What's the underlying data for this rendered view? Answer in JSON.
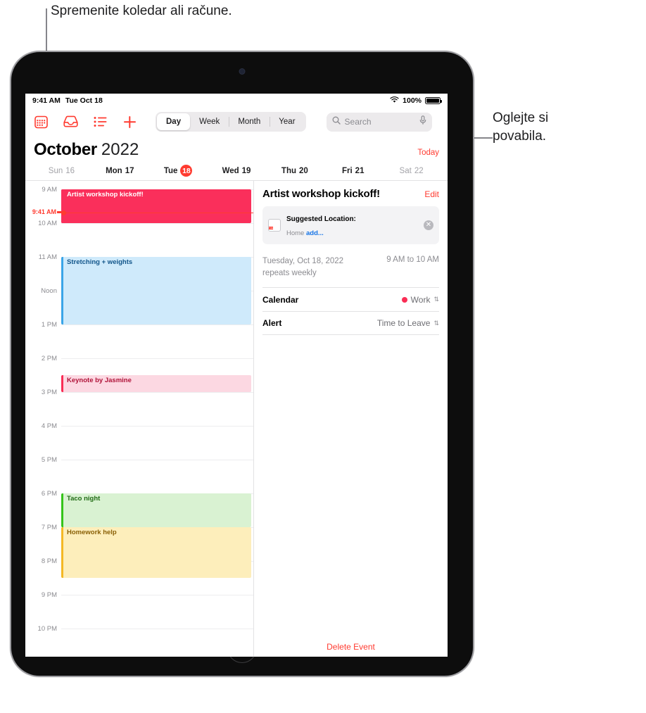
{
  "callouts": {
    "top": "Spremenite koledar ali račune.",
    "right": "Oglejte si\npovabila."
  },
  "statusbar": {
    "time": "9:41 AM",
    "date": "Tue Oct 18",
    "wifi_icon": "wifi-icon",
    "battery_text": "100%"
  },
  "toolbar": {
    "icons": [
      {
        "name": "calendars-icon",
        "label": "Calendars"
      },
      {
        "name": "inbox-icon",
        "label": "Inbox"
      },
      {
        "name": "list-icon",
        "label": "List"
      },
      {
        "name": "add-icon",
        "label": "Add"
      }
    ],
    "segments": [
      {
        "label": "Day",
        "selected": true
      },
      {
        "label": "Week",
        "selected": false
      },
      {
        "label": "Month",
        "selected": false
      },
      {
        "label": "Year",
        "selected": false
      }
    ],
    "search": {
      "placeholder": "Search",
      "value": "",
      "search_icon": "search-icon",
      "mic_icon": "microphone-icon"
    }
  },
  "header": {
    "month": "October",
    "year": "2022",
    "today_label": "Today"
  },
  "week": [
    {
      "weekday": "Sun",
      "daynum": "16",
      "dim": true,
      "selected": false
    },
    {
      "weekday": "Mon",
      "daynum": "17",
      "dim": false,
      "selected": false
    },
    {
      "weekday": "Tue",
      "daynum": "18",
      "dim": false,
      "selected": true
    },
    {
      "weekday": "Wed",
      "daynum": "19",
      "dim": false,
      "selected": false
    },
    {
      "weekday": "Thu",
      "daynum": "20",
      "dim": false,
      "selected": false
    },
    {
      "weekday": "Fri",
      "daynum": "21",
      "dim": false,
      "selected": false
    },
    {
      "weekday": "Sat",
      "daynum": "22",
      "dim": true,
      "selected": false
    }
  ],
  "daygrid": {
    "hours": [
      "9 AM",
      "10 AM",
      "11 AM",
      "Noon",
      "1 PM",
      "2 PM",
      "3 PM",
      "4 PM",
      "5 PM",
      "6 PM",
      "7 PM",
      "8 PM",
      "9 PM",
      "10 PM"
    ],
    "now": {
      "label": "9:41 AM",
      "color": "#ff3b30"
    },
    "events": [
      {
        "title": "Artist workshop kickoff!",
        "start": "9 AM",
        "end": "10 AM",
        "bg": "#fa2f5b",
        "stripe": "#fa2f5b",
        "text": "#ffffff",
        "selected": true
      },
      {
        "title": "Stretching + weights",
        "start": "11 AM",
        "end": "1 PM",
        "bg": "#cfeafb",
        "stripe": "#3aa5e8",
        "text": "#11558a",
        "selected": false
      },
      {
        "title": "Keynote by Jasmine",
        "start": "2:30 PM",
        "end": "3 PM",
        "bg": "#fcd8e2",
        "stripe": "#fa2d55",
        "text": "#b01238",
        "selected": false
      },
      {
        "title": "Taco night",
        "start": "6 PM",
        "end": "7 PM",
        "bg": "#d9f2d2",
        "stripe": "#35c41a",
        "text": "#1f6b13",
        "selected": false
      },
      {
        "title": "Homework help",
        "start": "7 PM",
        "end": "8:30 PM",
        "bg": "#fdeebb",
        "stripe": "#f4b825",
        "text": "#8a6006",
        "selected": false
      }
    ]
  },
  "inspector": {
    "title": "Artist workshop kickoff!",
    "edit_label": "Edit",
    "suggestion": {
      "badge_month": "TUE",
      "badge_day": "18",
      "title": "Suggested Location:",
      "sub_prefix": "Home ",
      "sub_link": "add...",
      "close_icon": "close-icon"
    },
    "when": {
      "date": "Tuesday, Oct 18, 2022",
      "repeat": "repeats weekly",
      "time_range": "9 AM to 10 AM"
    },
    "rows": [
      {
        "label": "Calendar",
        "value": "Work",
        "dot": "#fa2d55",
        "chevron": "⇅"
      },
      {
        "label": "Alert",
        "value": "Time to Leave",
        "dot": null,
        "chevron": "⇅"
      }
    ],
    "delete_label": "Delete Event"
  }
}
